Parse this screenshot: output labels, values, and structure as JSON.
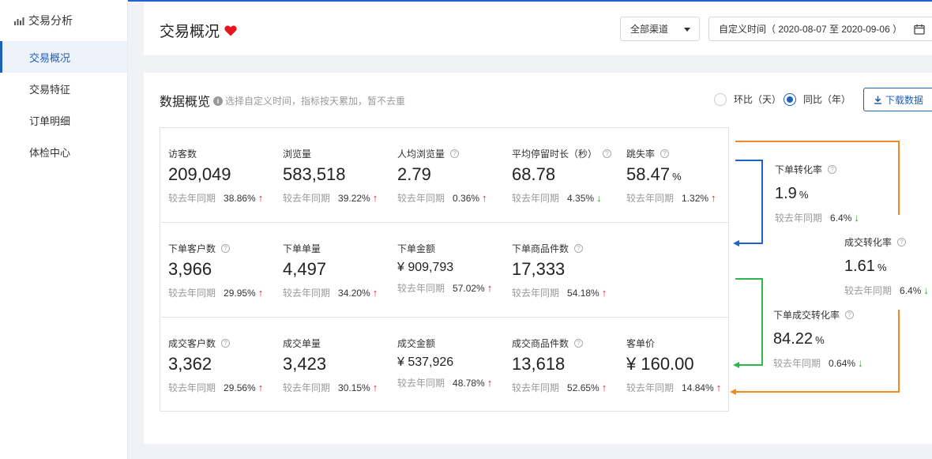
{
  "sidebar": {
    "header": "交易分析",
    "items": [
      {
        "label": "交易概况",
        "active": true
      },
      {
        "label": "交易特征",
        "active": false
      },
      {
        "label": "订单明细",
        "active": false
      },
      {
        "label": "体检中心",
        "active": false
      }
    ]
  },
  "header": {
    "title": "交易概况",
    "channel_select": "全部渠道",
    "date_range": "自定义时间（ 2020-08-07 至 2020-09-06 ）"
  },
  "overview": {
    "title": "数据概览",
    "hint": "选择自定义时间，指标按天累加，暂不去重",
    "radio_day": "环比（天）",
    "radio_year": "同比（年）",
    "selected": "year",
    "download": "下载数据"
  },
  "compare_label": "较去年同期",
  "colors": {
    "up": "#e02020",
    "down": "#2aa02a",
    "accent": "#1f5fb8",
    "orange": "#f08a24",
    "green": "#2fb84a",
    "blue": "#1e62d0"
  },
  "metrics": {
    "row1": [
      {
        "label": "访客数",
        "help": false,
        "value": "209,049",
        "unit": "",
        "pct": "38.86%",
        "dir": "up"
      },
      {
        "label": "浏览量",
        "help": false,
        "value": "583,518",
        "unit": "",
        "pct": "39.22%",
        "dir": "up"
      },
      {
        "label": "人均浏览量",
        "help": true,
        "value": "2.79",
        "unit": "",
        "pct": "0.36%",
        "dir": "up"
      },
      {
        "label": "平均停留时长（秒）",
        "help": true,
        "value": "68.78",
        "unit": "",
        "pct": "4.35%",
        "dir": "down"
      },
      {
        "label": "跳失率",
        "help": true,
        "value": "58.47",
        "unit": "%",
        "pct": "1.32%",
        "dir": "up"
      }
    ],
    "row2": [
      {
        "label": "下单客户数",
        "help": true,
        "value": "3,966",
        "unit": "",
        "pct": "29.95%",
        "dir": "up"
      },
      {
        "label": "下单单量",
        "help": false,
        "value": "4,497",
        "unit": "",
        "pct": "34.20%",
        "dir": "up"
      },
      {
        "label": "下单金额",
        "help": false,
        "value": "¥ 909,793",
        "unit": "",
        "pct": "57.02%",
        "dir": "up"
      },
      {
        "label": "下单商品件数",
        "help": true,
        "value": "17,333",
        "unit": "",
        "pct": "54.18%",
        "dir": "up"
      }
    ],
    "row3": [
      {
        "label": "成交客户数",
        "help": true,
        "value": "3,362",
        "unit": "",
        "pct": "29.56%",
        "dir": "up"
      },
      {
        "label": "成交单量",
        "help": false,
        "value": "3,423",
        "unit": "",
        "pct": "30.15%",
        "dir": "up"
      },
      {
        "label": "成交金额",
        "help": false,
        "value": "¥ 537,926",
        "unit": "",
        "pct": "48.78%",
        "dir": "up"
      },
      {
        "label": "成交商品件数",
        "help": true,
        "value": "13,618",
        "unit": "",
        "pct": "52.65%",
        "dir": "up"
      },
      {
        "label": "客单价",
        "help": false,
        "value": "¥ 160.00",
        "unit": "",
        "pct": "14.84%",
        "dir": "up"
      }
    ]
  },
  "conversions": [
    {
      "label": "下单转化率",
      "value": "1.9",
      "unit": "%",
      "pct": "6.4%",
      "dir": "down"
    },
    {
      "label": "成交转化率",
      "value": "1.61",
      "unit": "%",
      "pct": "6.4%",
      "dir": "down"
    },
    {
      "label": "下单成交转化率",
      "value": "84.22",
      "unit": "%",
      "pct": "0.64%",
      "dir": "down"
    }
  ]
}
